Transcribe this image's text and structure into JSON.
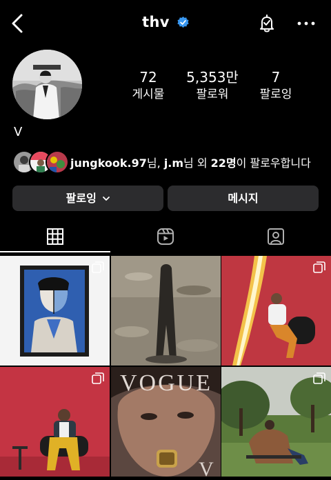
{
  "header": {
    "username": "thv"
  },
  "stats": [
    {
      "value": "72",
      "label": "게시물"
    },
    {
      "value": "5,353만",
      "label": "팔로워"
    },
    {
      "value": "7",
      "label": "팔로잉"
    }
  ],
  "profile": {
    "display_name": "V"
  },
  "followed_by": {
    "name1": "jungkook.97",
    "sep1": "님, ",
    "name2": "j.m",
    "sep2": "님 외 ",
    "count": "22명",
    "suffix": "이 팔로우합니다"
  },
  "buttons": {
    "following": "팔로잉",
    "message": "메시지"
  },
  "tabs": [
    {
      "icon": "grid-icon",
      "active": true
    },
    {
      "icon": "reels-icon",
      "active": false
    },
    {
      "icon": "tagged-icon",
      "active": false
    }
  ],
  "posts": [
    {
      "description": "painting",
      "multi": true
    },
    {
      "description": "shadow",
      "multi": false
    },
    {
      "description": "red-light",
      "multi": true
    },
    {
      "description": "red-chair",
      "multi": true
    },
    {
      "description": "vogue-cover",
      "multi": false
    },
    {
      "description": "outdoor-field",
      "multi": true
    }
  ],
  "colors": {
    "background": "#000000",
    "button": "#2c2c2e",
    "verified": "#3897f0"
  }
}
